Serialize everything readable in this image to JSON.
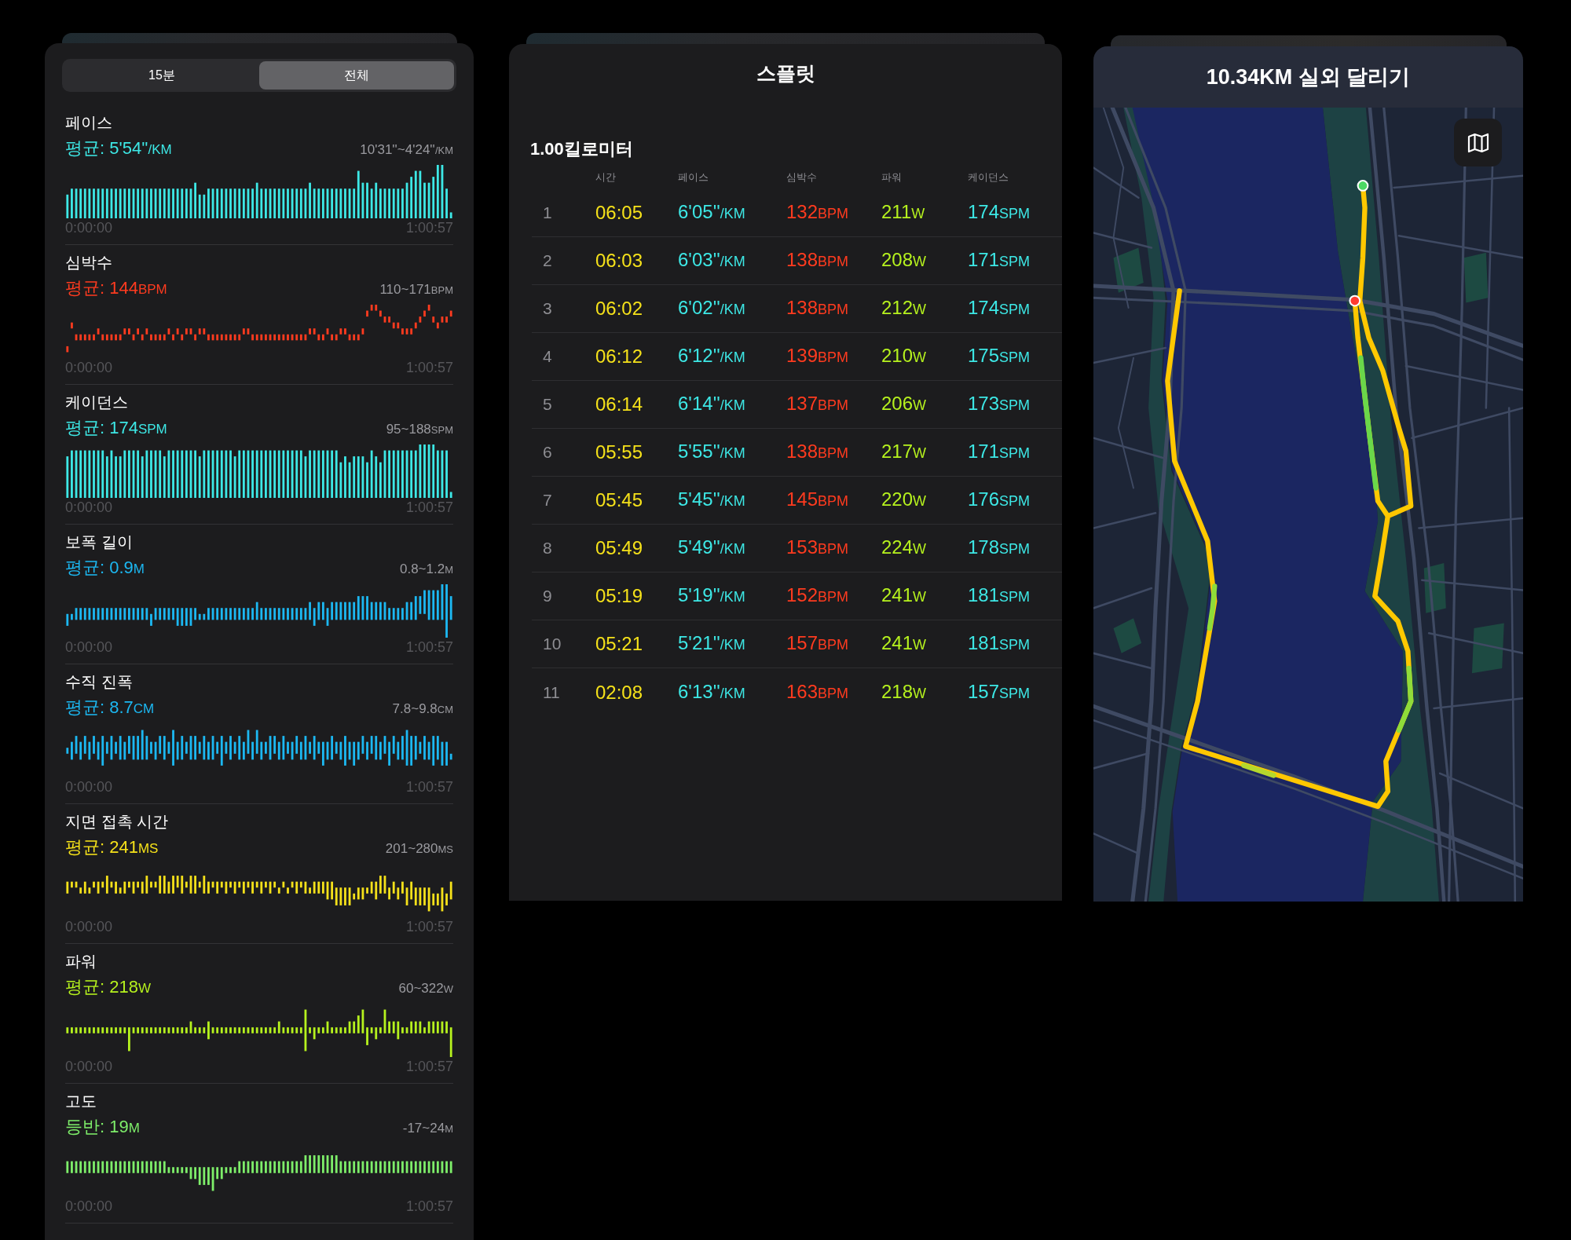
{
  "metrics_panel": {
    "segments": [
      {
        "label": "15분",
        "selected": false
      },
      {
        "label": "전체",
        "selected": true
      }
    ],
    "metrics": [
      {
        "title": "페이스",
        "average": "평균: 5'54''",
        "average_unit": "/KM",
        "range": "10'31''~4'24''",
        "range_unit": "/KM",
        "color": "#3de8e6",
        "axis_start": "0:00:00",
        "axis_end": "1:00:57"
      },
      {
        "title": "심박수",
        "average": "평균: 144",
        "average_unit": "BPM",
        "range": "110~171",
        "range_unit": "BPM",
        "color": "#ff3b1f",
        "axis_start": "0:00:00",
        "axis_end": "1:00:57"
      },
      {
        "title": "케이던스",
        "average": "평균: 174",
        "average_unit": "SPM",
        "range": "95~188",
        "range_unit": "SPM",
        "color": "#3de8e6",
        "axis_start": "0:00:00",
        "axis_end": "1:00:57"
      },
      {
        "title": "보폭 길이",
        "average": "평균: 0.9",
        "average_unit": "M",
        "range": "0.8~1.2",
        "range_unit": "M",
        "color": "#1cb8f2",
        "axis_start": "0:00:00",
        "axis_end": "1:00:57"
      },
      {
        "title": "수직 진폭",
        "average": "평균: 8.7",
        "average_unit": "CM",
        "range": "7.8~9.8",
        "range_unit": "CM",
        "color": "#1cb8f2",
        "axis_start": "0:00:00",
        "axis_end": "1:00:57"
      },
      {
        "title": "지면 접촉 시간",
        "average": "평균: 241",
        "average_unit": "MS",
        "range": "201~280",
        "range_unit": "MS",
        "color": "#f5e11a",
        "axis_start": "0:00:00",
        "axis_end": "1:00:57"
      },
      {
        "title": "파워",
        "average": "평균: 218",
        "average_unit": "W",
        "range": "60~322",
        "range_unit": "W",
        "color": "#b6f21e",
        "axis_start": "0:00:00",
        "axis_end": "1:00:57"
      },
      {
        "title": "고도",
        "average": "등반: 19",
        "average_unit": "M",
        "range": "-17~24",
        "range_unit": "M",
        "color": "#7eee6a",
        "axis_start": "0:00:00",
        "axis_end": "1:00:57"
      }
    ]
  },
  "splits_panel": {
    "title": "스플릿",
    "distance": "1.00킬로미터",
    "columns": [
      {
        "label": "시간",
        "color": "#f5e11a"
      },
      {
        "label": "페이스",
        "color": "#3de8e6"
      },
      {
        "label": "심박수",
        "color": "#ff3b1f"
      },
      {
        "label": "파워",
        "color": "#b6f21e"
      },
      {
        "label": "케이던스",
        "color": "#3de8e6"
      }
    ],
    "rows": [
      {
        "number": "1",
        "cells": [
          [
            "06:05"
          ],
          [
            "6'05''",
            "/KM"
          ],
          [
            "132",
            "BPM"
          ],
          [
            "211",
            "W"
          ],
          [
            "174",
            "SPM"
          ]
        ]
      },
      {
        "number": "2",
        "cells": [
          [
            "06:03"
          ],
          [
            "6'03''",
            "/KM"
          ],
          [
            "138",
            "BPM"
          ],
          [
            "208",
            "W"
          ],
          [
            "171",
            "SPM"
          ]
        ]
      },
      {
        "number": "3",
        "cells": [
          [
            "06:02"
          ],
          [
            "6'02''",
            "/KM"
          ],
          [
            "138",
            "BPM"
          ],
          [
            "212",
            "W"
          ],
          [
            "174",
            "SPM"
          ]
        ]
      },
      {
        "number": "4",
        "cells": [
          [
            "06:12"
          ],
          [
            "6'12''",
            "/KM"
          ],
          [
            "139",
            "BPM"
          ],
          [
            "210",
            "W"
          ],
          [
            "175",
            "SPM"
          ]
        ]
      },
      {
        "number": "5",
        "cells": [
          [
            "06:14"
          ],
          [
            "6'14''",
            "/KM"
          ],
          [
            "137",
            "BPM"
          ],
          [
            "206",
            "W"
          ],
          [
            "173",
            "SPM"
          ]
        ]
      },
      {
        "number": "6",
        "cells": [
          [
            "05:55"
          ],
          [
            "5'55''",
            "/KM"
          ],
          [
            "138",
            "BPM"
          ],
          [
            "217",
            "W"
          ],
          [
            "171",
            "SPM"
          ]
        ]
      },
      {
        "number": "7",
        "cells": [
          [
            "05:45"
          ],
          [
            "5'45''",
            "/KM"
          ],
          [
            "145",
            "BPM"
          ],
          [
            "220",
            "W"
          ],
          [
            "176",
            "SPM"
          ]
        ]
      },
      {
        "number": "8",
        "cells": [
          [
            "05:49"
          ],
          [
            "5'49''",
            "/KM"
          ],
          [
            "153",
            "BPM"
          ],
          [
            "224",
            "W"
          ],
          [
            "178",
            "SPM"
          ]
        ]
      },
      {
        "number": "9",
        "cells": [
          [
            "05:19"
          ],
          [
            "5'19''",
            "/KM"
          ],
          [
            "152",
            "BPM"
          ],
          [
            "241",
            "W"
          ],
          [
            "181",
            "SPM"
          ]
        ]
      },
      {
        "number": "10",
        "cells": [
          [
            "05:21"
          ],
          [
            "5'21''",
            "/KM"
          ],
          [
            "157",
            "BPM"
          ],
          [
            "241",
            "W"
          ],
          [
            "181",
            "SPM"
          ]
        ]
      },
      {
        "number": "11",
        "cells": [
          [
            "02:08"
          ],
          [
            "6'13''",
            "/KM"
          ],
          [
            "163",
            "BPM"
          ],
          [
            "218",
            "W"
          ],
          [
            "157",
            "SPM"
          ]
        ]
      }
    ]
  },
  "map_panel": {
    "title": "10.34KM 실외 달리기"
  }
}
